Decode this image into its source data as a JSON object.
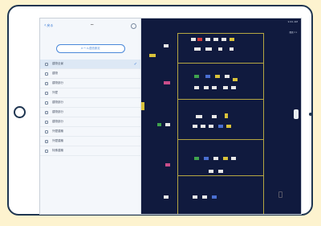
{
  "sidebar": {
    "back_label": "戻る",
    "title_icon": "wifi-icon",
    "pill_button": "メール送信設定",
    "items": [
      {
        "label": "建物全景",
        "selected": true
      },
      {
        "label": "建物",
        "selected": false
      },
      {
        "label": "建物部分",
        "selected": false
      },
      {
        "label": "外壁",
        "selected": false
      },
      {
        "label": "建物部分",
        "selected": false
      },
      {
        "label": "建物部分",
        "selected": false
      },
      {
        "label": "建物部分",
        "selected": false
      },
      {
        "label": "外壁建築",
        "selected": false
      },
      {
        "label": "外壁建築",
        "selected": false
      },
      {
        "label": "特殊建築",
        "selected": false
      }
    ]
  },
  "map": {
    "status_text": "9:41 AM",
    "header_label": "図面 1 ▾"
  },
  "colors": {
    "background": "#fdf3cf",
    "frame": "#1e3550",
    "map_bg": "#101a3e",
    "grid": "#b5a642",
    "accent": "#4a88d9"
  }
}
